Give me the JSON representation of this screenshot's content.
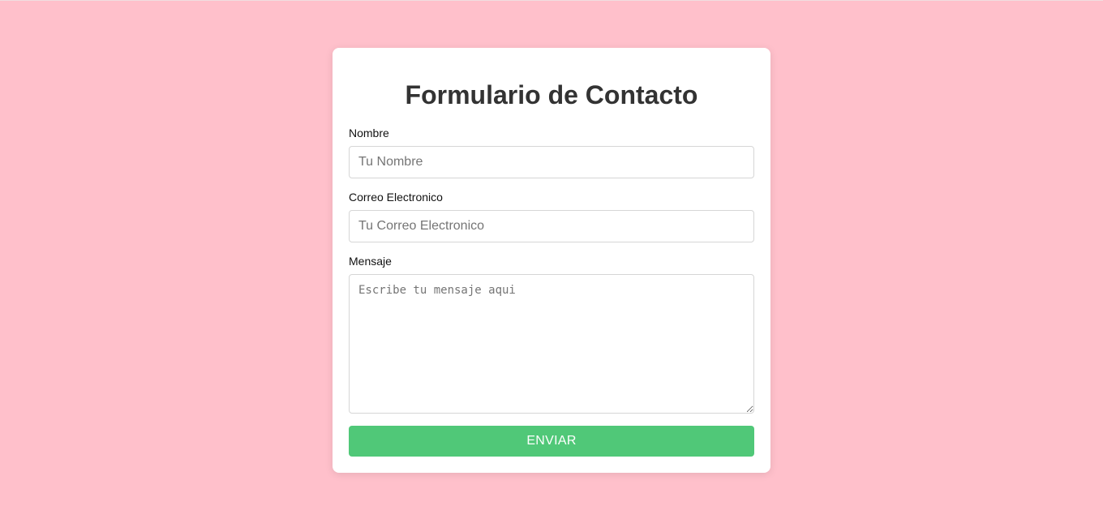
{
  "form": {
    "title": "Formulario de Contacto",
    "name_label": "Nombre",
    "name_placeholder": "Tu Nombre",
    "name_value": "",
    "email_label": "Correo Electronico",
    "email_placeholder": "Tu Correo Electronico",
    "email_value": "",
    "message_label": "Mensaje",
    "message_placeholder": "Escribe tu mensaje aqui",
    "message_value": "",
    "submit_label": "ENVIAR"
  },
  "colors": {
    "background": "#ffc0cb",
    "card": "#ffffff",
    "title": "#333333",
    "button": "#50c878",
    "button_text": "#ffffff"
  }
}
